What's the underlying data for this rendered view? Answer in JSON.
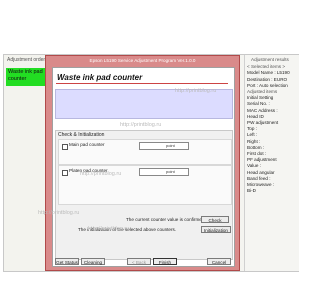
{
  "left_panel": {
    "title": "Adjustment order",
    "item": "Waste ink pad counter"
  },
  "modal": {
    "title": "Epson L5190 Service Adjustment Program Ver.1.0.0",
    "heading": "Waste ink pad counter",
    "section_label": "Check & Initialization",
    "rows": [
      {
        "label": "Main pad counter",
        "unit": "point"
      },
      {
        "label": "Platen pad counter",
        "unit": "point"
      }
    ],
    "notice_line1": "The current counter value is confirmed.",
    "notice_line2": "The initialization of the selected above counters.",
    "check_button": "Check",
    "init_button": "Initialization",
    "footer_buttons": {
      "get_status": "Get Status",
      "cleaning": "Cleaning",
      "back": "< Back",
      "finish": "Finish",
      "cancel": "Cancel"
    }
  },
  "right_panel": {
    "title": "Adjustment results",
    "lines": [
      {
        "text": "< Selected items >",
        "hdr": true
      },
      {
        "text": "Model Name : L5190",
        "hdr": false
      },
      {
        "text": "Destination : EURO",
        "hdr": false
      },
      {
        "text": "Port : Auto selection",
        "hdr": false
      },
      {
        "text": "",
        "hdr": false
      },
      {
        "text": "Adjusted items",
        "hdr": true
      },
      {
        "text": "",
        "hdr": false
      },
      {
        "text": "Initial Setting",
        "hdr": false
      },
      {
        "text": "",
        "hdr": false
      },
      {
        "text": "Serial No. :",
        "hdr": false
      },
      {
        "text": "",
        "hdr": false
      },
      {
        "text": "MAC Address :",
        "hdr": false
      },
      {
        "text": "",
        "hdr": false
      },
      {
        "text": "Head ID",
        "hdr": false
      },
      {
        "text": "",
        "hdr": false
      },
      {
        "text": "PW adjustment",
        "hdr": false
      },
      {
        "text": "Top :",
        "hdr": false
      },
      {
        "text": "Left :",
        "hdr": false
      },
      {
        "text": "Right :",
        "hdr": false
      },
      {
        "text": "Bottom :",
        "hdr": false
      },
      {
        "text": "First dot :",
        "hdr": false
      },
      {
        "text": "",
        "hdr": false
      },
      {
        "text": "PF adjustment",
        "hdr": false
      },
      {
        "text": "Value :",
        "hdr": false
      },
      {
        "text": "",
        "hdr": false
      },
      {
        "text": "Head angular",
        "hdr": false
      },
      {
        "text": "Band feed :",
        "hdr": false
      },
      {
        "text": "Microweave :",
        "hdr": false
      },
      {
        "text": "",
        "hdr": false
      },
      {
        "text": "Bi-D",
        "hdr": false
      }
    ]
  },
  "watermarks": [
    "http://printblog.ru",
    "http://printblog.ru",
    "http://printblog.ru",
    "http://printblog.ru",
    "http://printblog.ru"
  ]
}
